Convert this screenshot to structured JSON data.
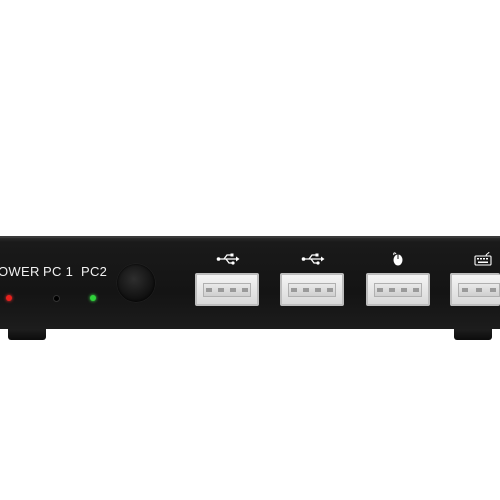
{
  "panel": {
    "power_label": "OWER",
    "pc1_label": "PC 1",
    "pc2_label": "PC2"
  },
  "leds": {
    "power_color": "#e8201c",
    "pc1_color": "#000000",
    "pc2_color": "#2fd23a"
  },
  "ports": [
    {
      "icon": "usb-icon"
    },
    {
      "icon": "usb-icon"
    },
    {
      "icon": "mouse-icon"
    },
    {
      "icon": "keyboard-icon"
    }
  ],
  "colors": {
    "body": "#161616",
    "label_text": "#f2f2f2",
    "port_metal": "#e2e2e2"
  }
}
